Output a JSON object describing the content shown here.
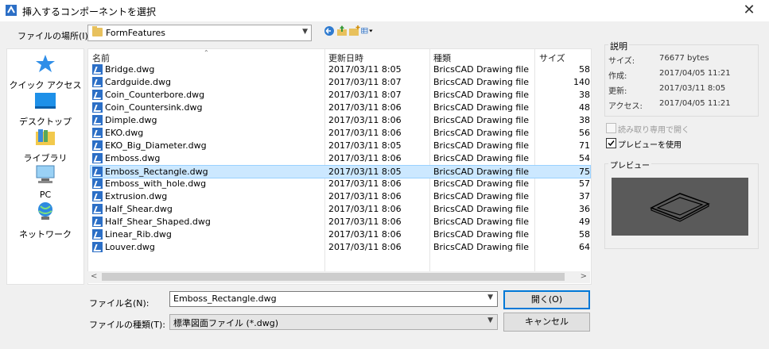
{
  "window": {
    "title": "挿入するコンポーネントを選択",
    "close": "✕"
  },
  "lookin": {
    "label": "ファイルの場所(I):",
    "value": "FormFeatures"
  },
  "places": [
    {
      "label": "クイック アクセス",
      "icon": "star-icon"
    },
    {
      "label": "デスクトップ",
      "icon": "desktop-icon"
    },
    {
      "label": "ライブラリ",
      "icon": "library-icon"
    },
    {
      "label": "PC",
      "icon": "pc-icon"
    },
    {
      "label": "ネットワーク",
      "icon": "network-icon"
    }
  ],
  "columns": {
    "name": "名前",
    "date": "更新日時",
    "type": "種類",
    "size": "サイズ"
  },
  "files": [
    {
      "name": "Bridge.dwg",
      "date": "2017/03/11 8:05",
      "type": "BricsCAD Drawing file",
      "size": "58"
    },
    {
      "name": "Cardguide.dwg",
      "date": "2017/03/11 8:07",
      "type": "BricsCAD Drawing file",
      "size": "140"
    },
    {
      "name": "Coin_Counterbore.dwg",
      "date": "2017/03/11 8:07",
      "type": "BricsCAD Drawing file",
      "size": "38"
    },
    {
      "name": "Coin_Countersink.dwg",
      "date": "2017/03/11 8:06",
      "type": "BricsCAD Drawing file",
      "size": "48"
    },
    {
      "name": "Dimple.dwg",
      "date": "2017/03/11 8:06",
      "type": "BricsCAD Drawing file",
      "size": "38"
    },
    {
      "name": "EKO.dwg",
      "date": "2017/03/11 8:06",
      "type": "BricsCAD Drawing file",
      "size": "56"
    },
    {
      "name": "EKO_Big_Diameter.dwg",
      "date": "2017/03/11 8:05",
      "type": "BricsCAD Drawing file",
      "size": "71"
    },
    {
      "name": "Emboss.dwg",
      "date": "2017/03/11 8:06",
      "type": "BricsCAD Drawing file",
      "size": "54"
    },
    {
      "name": "Emboss_Rectangle.dwg",
      "date": "2017/03/11 8:05",
      "type": "BricsCAD Drawing file",
      "size": "75",
      "selected": true
    },
    {
      "name": "Emboss_with_hole.dwg",
      "date": "2017/03/11 8:06",
      "type": "BricsCAD Drawing file",
      "size": "57"
    },
    {
      "name": "Extrusion.dwg",
      "date": "2017/03/11 8:06",
      "type": "BricsCAD Drawing file",
      "size": "37"
    },
    {
      "name": "Half_Shear.dwg",
      "date": "2017/03/11 8:06",
      "type": "BricsCAD Drawing file",
      "size": "36"
    },
    {
      "name": "Half_Shear_Shaped.dwg",
      "date": "2017/03/11 8:06",
      "type": "BricsCAD Drawing file",
      "size": "49"
    },
    {
      "name": "Linear_Rib.dwg",
      "date": "2017/03/11 8:06",
      "type": "BricsCAD Drawing file",
      "size": "58"
    },
    {
      "name": "Louver.dwg",
      "date": "2017/03/11 8:06",
      "type": "BricsCAD Drawing file",
      "size": "64"
    }
  ],
  "filename": {
    "label": "ファイル名(N):",
    "value": "Emboss_Rectangle.dwg"
  },
  "filetype": {
    "label": "ファイルの種類(T):",
    "value": "標準図面ファイル (*.dwg)"
  },
  "buttons": {
    "open": "開く(O)",
    "cancel": "キャンセル"
  },
  "description": {
    "title": "説明",
    "size_label": "サイズ:",
    "size_value": "76677 bytes",
    "created_label": "作成:",
    "created_value": "2017/04/05 11:21",
    "modified_label": "更新:",
    "modified_value": "2017/03/11 8:05",
    "access_label": "アクセス:",
    "access_value": "2017/04/05 11:21"
  },
  "options": {
    "readonly": "読み取り専用で開く",
    "preview": "プレビューを使用"
  },
  "preview": {
    "title": "プレビュー"
  },
  "colors": {
    "accent": "#0078d7",
    "selection": "#cce8ff"
  }
}
